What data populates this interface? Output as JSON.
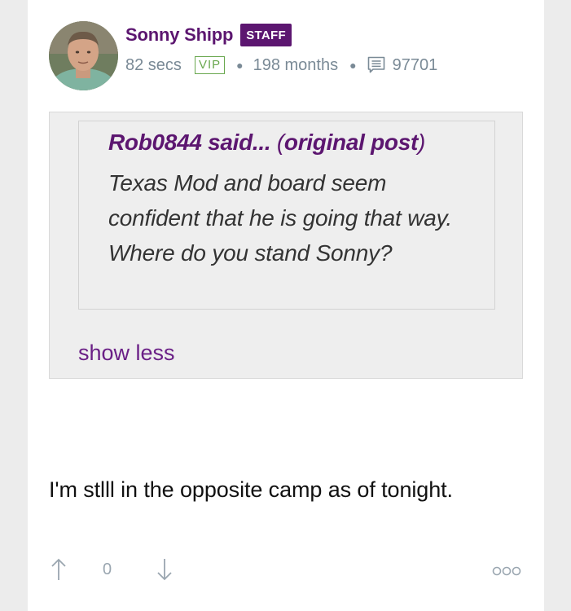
{
  "post": {
    "author": {
      "name": "Sonny Shipp",
      "badge": "STAFF",
      "vip": "VIP"
    },
    "meta": {
      "time": "82 secs",
      "tenure": "198 months",
      "post_count": "97701"
    },
    "quote": {
      "author_said": "Rob0844 said...",
      "open_paren": "(",
      "original_post_link": "original post",
      "close_paren": ")",
      "text": "Texas Mod and board seem confident that he is going that way. Where do you stand Sonny?"
    },
    "show_less_label": "show less",
    "body": "I'm stlll in the opposite camp as of tonight.",
    "actions": {
      "vote_count": "0"
    }
  },
  "colors": {
    "brand_purple": "#5c1670",
    "vip_green": "#6aa84f",
    "meta_gray": "#7a8a96",
    "quote_bg": "#eeeeee"
  },
  "icons": {
    "upvote": "arrow-up-icon",
    "downvote": "arrow-down-icon",
    "comments": "comment-icon",
    "more": "more-options-icon"
  }
}
